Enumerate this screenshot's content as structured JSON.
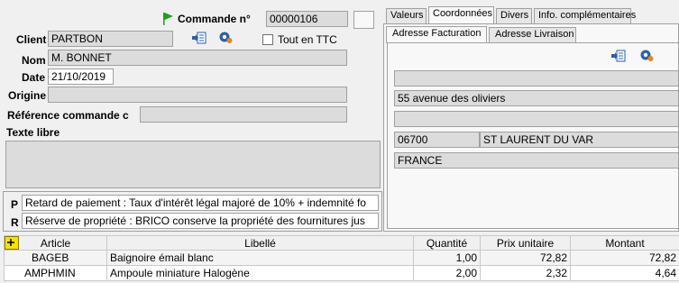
{
  "order": {
    "label": "Commande n°",
    "number": "00000106",
    "client_label": "Client",
    "client_value": "PARTBON",
    "ttc_label": "Tout en TTC",
    "nom_label": "Nom",
    "nom_value": "M. BONNET",
    "date_label": "Date",
    "date_value": "21/10/2019",
    "origine_label": "Origine",
    "origine_value": "",
    "ref_label": "Référence commande c",
    "ref_value": "",
    "texte_label": "Texte libre",
    "texte_value": ""
  },
  "conditions": [
    {
      "letter": "P",
      "text": "Retard de paiement : Taux d'intérêt légal majoré de 10% + indemnité fo"
    },
    {
      "letter": "R",
      "text": "Réserve de propriété : BRICO conserve la propriété des fournitures jus"
    }
  ],
  "tabs": [
    "Valeurs",
    "Coordonnées",
    "Divers",
    "Info. complémentaires"
  ],
  "active_tab": "Coordonnées",
  "subtabs": [
    "Adresse Facturation",
    "Adresse Livraison"
  ],
  "address": {
    "line1": "",
    "line2": "55 avenue des oliviers",
    "line3": "",
    "postcode": "06700",
    "city": "ST LAURENT DU VAR",
    "country": "FRANCE"
  },
  "grid": {
    "columns": [
      "Article",
      "Libellé",
      "Quantité",
      "Prix unitaire",
      "Montant"
    ],
    "rows": [
      {
        "article": "BAGEB",
        "libelle": "Baignoire émail blanc",
        "quantite": "1,00",
        "prix": "72,82",
        "montant": "72,82"
      },
      {
        "article": "AMPHMIN",
        "libelle": "Ampoule miniature Halogène",
        "quantite": "2,00",
        "prix": "2,32",
        "montant": "4,64"
      }
    ]
  },
  "colors": {
    "accent_green": "#1aa31a",
    "gear_blue": "#2b5fa8",
    "gear_orange": "#e08a1e"
  },
  "icons": [
    "flag-icon",
    "link-icon",
    "gear-icon",
    "add-row-icon"
  ]
}
